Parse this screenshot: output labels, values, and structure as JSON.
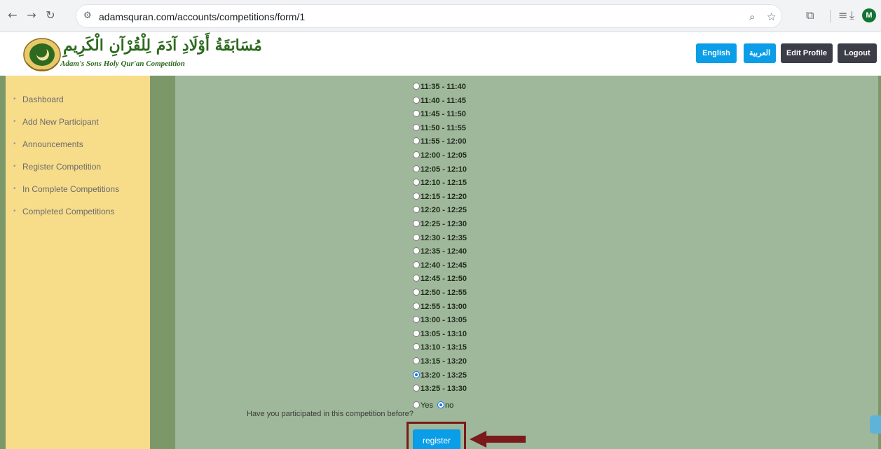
{
  "browser": {
    "url": "adamsquran.com/accounts/competitions/form/1",
    "avatar_letter": "M"
  },
  "header": {
    "logo_arabic": "مُسَابَقَةُ أَوْلَادِ آدَمَ لِلْقُرْآنِ الْكَرِيمِ",
    "logo_english": "Adam's Sons Holy Qur'an Competition",
    "buttons": {
      "english": "English",
      "arabic": "العربية",
      "edit_profile": "Edit Profile",
      "logout": "Logout"
    }
  },
  "sidebar": {
    "items": [
      "Dashboard",
      "Add New Participant",
      "Announcements",
      "Register Competition",
      "In Complete Competitions",
      "Completed Competitions"
    ]
  },
  "form": {
    "slots": [
      "11:35 - 11:40",
      "11:40 - 11:45",
      "11:45 - 11:50",
      "11:50 - 11:55",
      "11:55 - 12:00",
      "12:00 - 12:05",
      "12:05 - 12:10",
      "12:10 - 12:15",
      "12:15 - 12:20",
      "12:20 - 12:25",
      "12:25 - 12:30",
      "12:30 - 12:35",
      "12:35 - 12:40",
      "12:40 - 12:45",
      "12:45 - 12:50",
      "12:50 - 12:55",
      "12:55 - 13:00",
      "13:00 - 13:05",
      "13:05 - 13:10",
      "13:10 - 13:15",
      "13:15 - 13:20",
      "13:20 - 13:25",
      "13:25 - 13:30"
    ],
    "selected_slot": "13:20 - 13:25",
    "question": "Have you participated in this competition before?",
    "yes_label": "Yes",
    "no_label": "no",
    "selected_answer": "no",
    "register_label": "register"
  },
  "colors": {
    "sidebar_bg": "#f7dc8a",
    "main_bg": "#9fb79a",
    "accent_blue": "#0a9de8",
    "highlight_frame": "#7a1a1a"
  }
}
